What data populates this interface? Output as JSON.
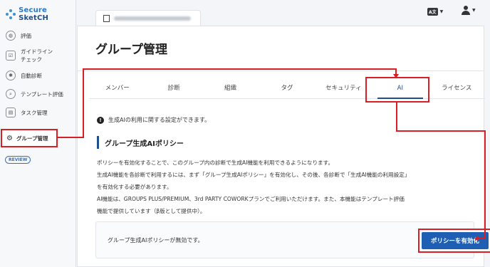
{
  "logo": {
    "prefix": "Secure ",
    "brand": "SketCH"
  },
  "sidebar": {
    "items": [
      {
        "label": "評価",
        "icon": "evaluation-icon"
      },
      {
        "label": "ガイドライン\nチェック",
        "icon": "guideline-check-icon"
      },
      {
        "label": "自動診断",
        "icon": "auto-diagnosis-icon"
      },
      {
        "label": "テンプレート評価",
        "icon": "template-search-icon"
      },
      {
        "label": "タスク管理",
        "icon": "task-icon"
      }
    ],
    "active": {
      "label": "グループ管理",
      "icon": "gear-icon"
    },
    "review_badge": "REVIEW"
  },
  "topbar": {
    "lang_label": "A文",
    "lang_icon": "language-icon",
    "user_icon": "user-icon"
  },
  "page": {
    "title": "グループ管理"
  },
  "tabs": [
    {
      "label": "メンバー"
    },
    {
      "label": "診断"
    },
    {
      "label": "組織"
    },
    {
      "label": "タグ"
    },
    {
      "label": "セキュリティ"
    },
    {
      "label": "AI",
      "active": true
    },
    {
      "label": "ライセンス"
    }
  ],
  "info": {
    "text": "生成AIの利用に関する設定ができます。"
  },
  "section": {
    "title": "グループ生成AIポリシー",
    "paragraphs": [
      "ポリシーを有効化することで、このグループ内の診断で生成AI機能を利用できるようになります。",
      "生成AI機能を各診断で利用するには、まず「グループ生成AIポリシー」を有効化し、その後、各診断で「生成AI機能の利用設定」",
      "を有効化する必要があります。",
      "AI機能は、GROUPS PLUS/PREMIUM、3rd PARTY COWORKプランでご利用いただけます。また、本機能はテンプレート評価",
      "機能で提供しています（β版として提供中）。"
    ]
  },
  "policy": {
    "status_text": "グループ生成AIポリシーが無効です。",
    "button_label": "ポリシーを有効化"
  },
  "colors": {
    "accent": "#1f5fb3",
    "annotation": "#d81f26"
  }
}
